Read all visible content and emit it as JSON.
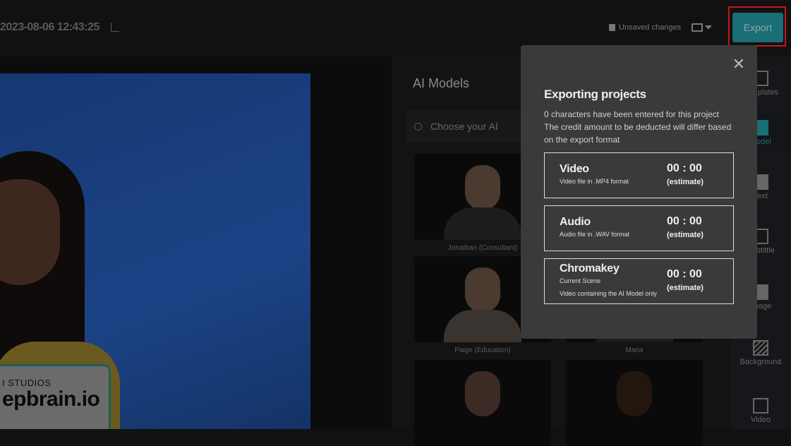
{
  "header": {
    "project_title": "2023-08-06 12:43:25",
    "unsaved": "Unsaved changes",
    "export_label": "Export",
    "accent": "#1a6e75",
    "highlight": "#c8141a"
  },
  "canvas": {
    "caption_small": "I STUDIOS",
    "caption_big": "epbrain.io"
  },
  "models": {
    "title": "AI Models",
    "search_placeholder": "Choose your AI",
    "cards": [
      {
        "label": "Jonathan (Consultant)"
      },
      {
        "label": ""
      },
      {
        "label": "Paige (Education)"
      },
      {
        "label": "Maria"
      },
      {
        "label": ""
      },
      {
        "label": ""
      }
    ]
  },
  "sidebar": {
    "items": [
      {
        "label": "Templates",
        "icon": "templates-icon"
      },
      {
        "label": "Model",
        "icon": "model-icon",
        "active": true
      },
      {
        "label": "Text",
        "icon": "text-icon"
      },
      {
        "label": "Subtittle",
        "icon": "subtitle-icon"
      },
      {
        "label": "Image",
        "icon": "image-icon"
      },
      {
        "label": "Background",
        "icon": "background-icon"
      },
      {
        "label": "Video",
        "icon": "video-icon"
      }
    ]
  },
  "modal": {
    "title": "Exporting projects",
    "desc_line1": "0 characters have been entered for this project",
    "desc_line2": "The credit amount to be deducted will differ based on the export format",
    "options": [
      {
        "name": "Video",
        "sub": "Video file in .MP4 format",
        "time": "00 : 00",
        "estimate": "(estimate)"
      },
      {
        "name": "Audio",
        "sub": "Audio file in .WAV format",
        "time": "00 : 00",
        "estimate": "(estimate)"
      },
      {
        "name": "Chromakey",
        "sub": "Current Scene",
        "sub2": "Video containing the AI Model only",
        "time": "00 : 00",
        "estimate": "(estimate)"
      }
    ]
  }
}
